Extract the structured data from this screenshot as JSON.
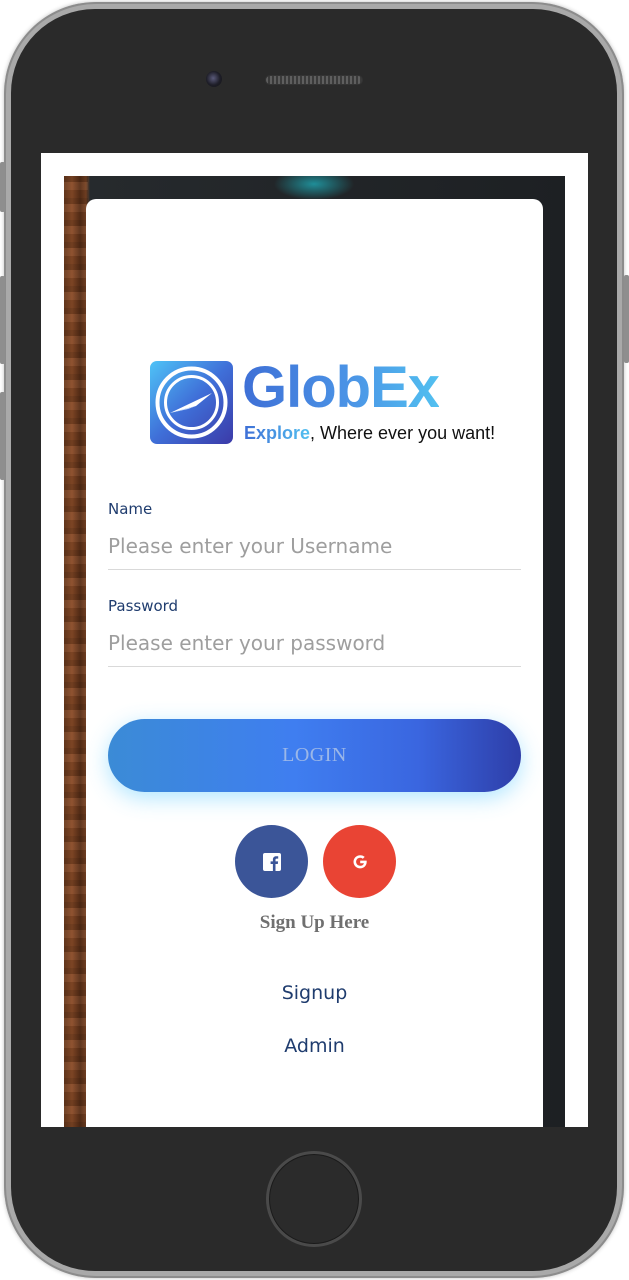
{
  "app": {
    "logo": {
      "name": "GlobEx",
      "tagline_accent": "Explore",
      "tagline_rest": ", Where ever you want!",
      "icon": "compass-icon"
    }
  },
  "form": {
    "name_label": "Name",
    "name_placeholder": "Please enter your Username",
    "name_value": "",
    "password_label": "Password",
    "password_placeholder": "Please enter your password",
    "password_value": "",
    "login_label": "LOGIN"
  },
  "social": {
    "facebook_icon": "facebook-icon",
    "google_icon": "google-icon",
    "facebook_color": "#3b5598",
    "google_color": "#e94434",
    "caption": "Sign Up Here"
  },
  "links": {
    "signup": "Signup",
    "admin": "Admin"
  },
  "theme": {
    "accent": "#1f3c6e",
    "button_gradient_start": "#3b8bd6",
    "button_gradient_end": "#2e3ea8"
  }
}
